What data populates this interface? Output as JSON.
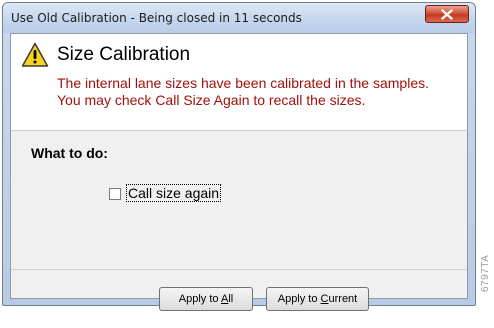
{
  "window": {
    "title": "Use Old Calibration - Being closed in 11 seconds"
  },
  "header": {
    "title": "Size Calibration",
    "message_lines": [
      "The internal lane sizes have been calibrated in the samples.",
      "You may check Call Size Again to recall the sizes."
    ],
    "icon": "warning-icon"
  },
  "options": {
    "section_label": "What to do:",
    "call_size_again": {
      "label": "Call size again",
      "checked": false
    }
  },
  "buttons": {
    "apply_all": {
      "label": "Apply to All",
      "mnemonic": "A"
    },
    "apply_current": {
      "label": "Apply to Current",
      "mnemonic": "C"
    }
  },
  "figure_code": "6797TA",
  "colors": {
    "message_text": "#a2100b",
    "close_button": "#c13b22",
    "client_background": "#f0f0f0"
  }
}
